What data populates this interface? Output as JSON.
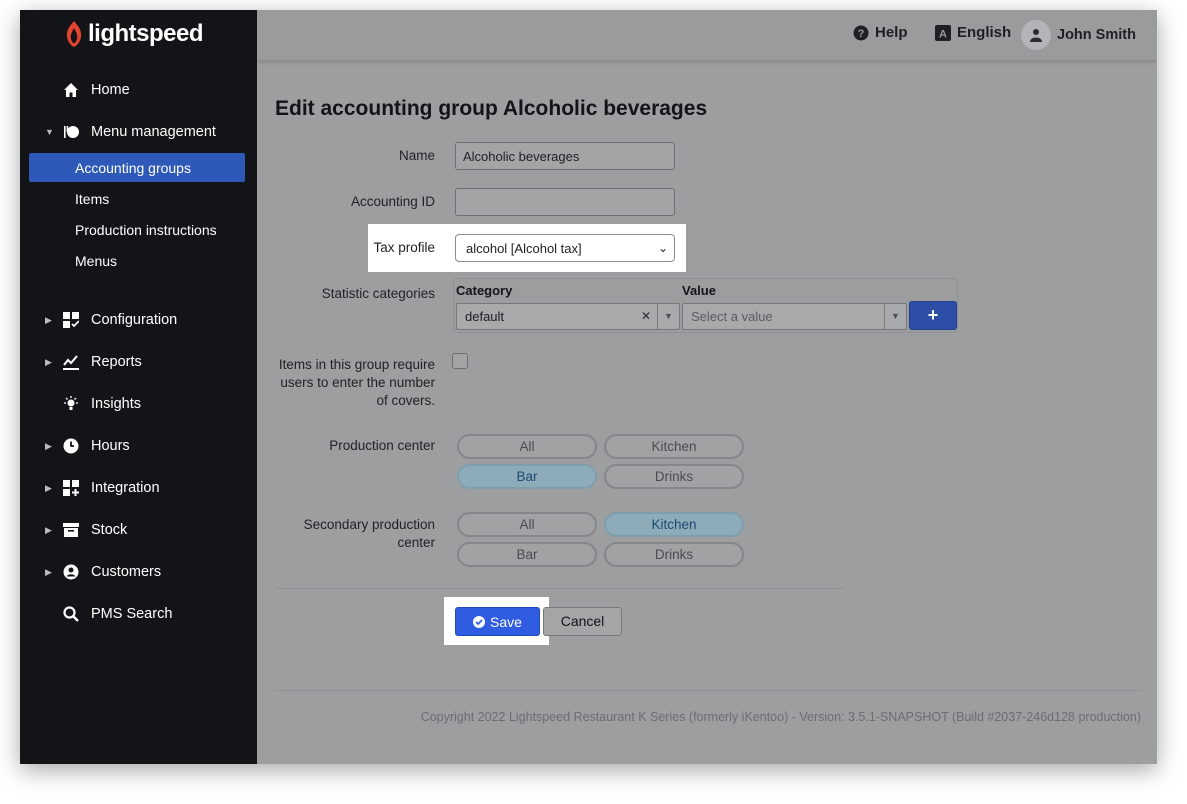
{
  "brand": {
    "name": "lightspeed",
    "color": "#e4432d"
  },
  "sidebar": {
    "items": [
      {
        "label": "Home",
        "icon": "home-icon"
      },
      {
        "label": "Menu management",
        "icon": "menu-management-icon",
        "expanded": true
      },
      {
        "label": "Configuration",
        "icon": "configuration-icon"
      },
      {
        "label": "Reports",
        "icon": "reports-icon"
      },
      {
        "label": "Insights",
        "icon": "insights-icon"
      },
      {
        "label": "Hours",
        "icon": "clock-icon"
      },
      {
        "label": "Integration",
        "icon": "integration-icon"
      },
      {
        "label": "Stock",
        "icon": "stock-icon"
      },
      {
        "label": "Customers",
        "icon": "customers-icon"
      },
      {
        "label": "PMS Search",
        "icon": "search-icon"
      }
    ],
    "subitems": [
      {
        "label": "Accounting groups",
        "active": true
      },
      {
        "label": "Items"
      },
      {
        "label": "Production instructions"
      },
      {
        "label": "Menus"
      }
    ]
  },
  "topbar": {
    "help": "Help",
    "language": "English",
    "user": "John Smith"
  },
  "form": {
    "title": "Edit accounting group Alcoholic beverages",
    "name_label": "Name",
    "name_value": "Alcoholic beverages",
    "accounting_id_label": "Accounting ID",
    "accounting_id_value": "",
    "tax_profile_label": "Tax profile",
    "tax_profile_value": "alcohol [Alcohol tax]",
    "statistic_label": "Statistic categories",
    "statistic_category_header": "Category",
    "statistic_value_header": "Value",
    "statistic_category_value": "default",
    "statistic_value_placeholder": "Select a value",
    "covers_label": "Items in this group require users to enter the number of covers.",
    "covers_checked": false,
    "production_center_label": "Production center",
    "production_center_options": [
      {
        "label": "All",
        "selected": false
      },
      {
        "label": "Kitchen",
        "selected": false
      },
      {
        "label": "Bar",
        "selected": true
      },
      {
        "label": "Drinks",
        "selected": false
      }
    ],
    "secondary_label": "Secondary production center",
    "secondary_options": [
      {
        "label": "All",
        "selected": false
      },
      {
        "label": "Kitchen",
        "selected": true
      },
      {
        "label": "Bar",
        "selected": false
      },
      {
        "label": "Drinks",
        "selected": false
      }
    ],
    "save_label": "Save",
    "cancel_label": "Cancel"
  },
  "footer": {
    "copyright": "Copyright 2022 Lightspeed Restaurant K Series (formerly iKentoo) - Version: 3.5.1-SNAPSHOT (Build #2037-246d128 production)"
  },
  "colors": {
    "accent": "#2f5ce0",
    "sidebar_bg": "#121417",
    "active_item": "#2e59b8"
  }
}
